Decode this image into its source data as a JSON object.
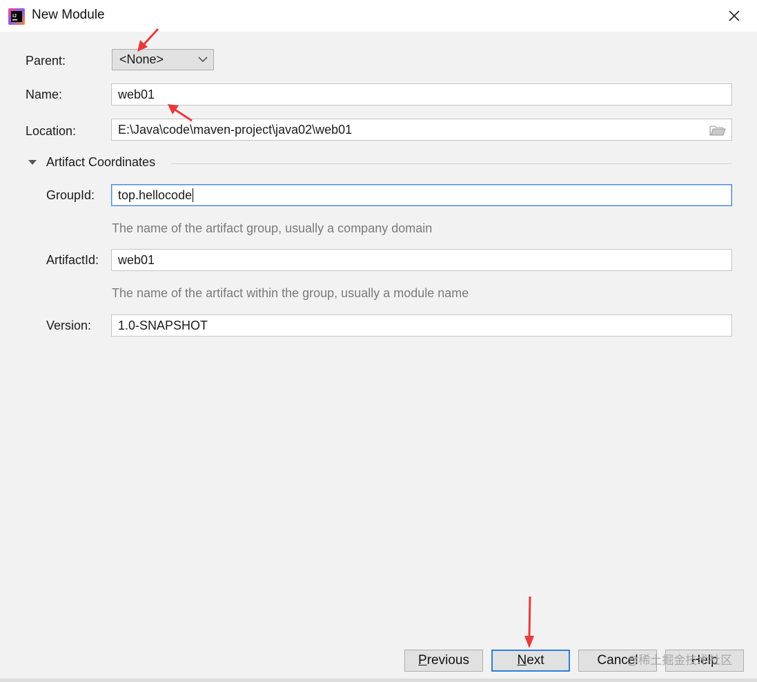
{
  "window": {
    "title": "New Module",
    "icon": "intellij-idea-icon"
  },
  "form": {
    "parent": {
      "label": "Parent:",
      "value": "<None>"
    },
    "name": {
      "label": "Name:",
      "value": "web01"
    },
    "location": {
      "label": "Location:",
      "value": "E:\\Java\\code\\maven-project\\java02\\web01"
    }
  },
  "artifact": {
    "section_title": "Artifact Coordinates",
    "groupId": {
      "label": "GroupId:",
      "value": "top.hellocode",
      "hint": "The name of the artifact group, usually a company domain"
    },
    "artifactId": {
      "label": "ArtifactId:",
      "value": "web01",
      "hint": "The name of the artifact within the group, usually a module name"
    },
    "version": {
      "label": "Version:",
      "value": "1.0-SNAPSHOT"
    }
  },
  "buttons": {
    "previous": {
      "mnemonic": "P",
      "rest": "revious"
    },
    "next": {
      "mnemonic": "N",
      "rest": "ext"
    },
    "cancel": {
      "label": "Cancel"
    },
    "help": {
      "label": "Help"
    }
  },
  "watermark": "@稀土掘金技术社区",
  "colors": {
    "focus": "#2f7fd6",
    "annotation_arrow": "#e83a3a",
    "hint": "#7a7a7a"
  }
}
